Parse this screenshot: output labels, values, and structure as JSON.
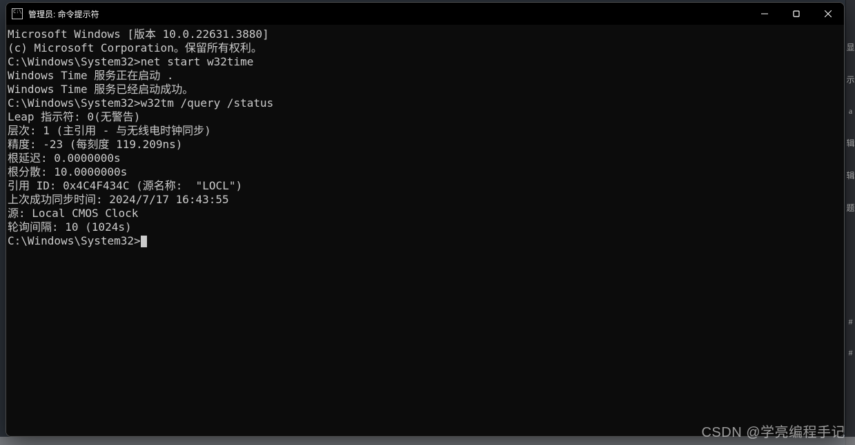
{
  "window": {
    "title": "管理员: 命令提示符",
    "icon_label": "cmd-icon"
  },
  "terminal": {
    "lines": [
      "Microsoft Windows [版本 10.0.22631.3880]",
      "(c) Microsoft Corporation。保留所有权利。",
      "",
      "C:\\Windows\\System32>net start w32time",
      "Windows Time 服务正在启动 .",
      "Windows Time 服务已经启动成功。",
      "",
      "",
      "C:\\Windows\\System32>w32tm /query /status",
      "Leap 指示符: 0(无警告)",
      "层次: 1 (主引用 - 与无线电时钟同步)",
      "精度: -23 (每刻度 119.209ns)",
      "根延迟: 0.0000000s",
      "根分散: 10.0000000s",
      "引用 ID: 0x4C4F434C (源名称:  \"LOCL\")",
      "上次成功同步时间: 2024/7/17 16:43:55",
      "源: Local CMOS Clock",
      "轮询间隔: 10 (1024s)",
      "",
      "",
      "C:\\Windows\\System32>"
    ]
  },
  "watermark": "CSDN @学亮编程手记",
  "right_strip": [
    "显",
    "示",
    "a",
    "辑",
    "辑",
    "题",
    "#",
    "#"
  ]
}
